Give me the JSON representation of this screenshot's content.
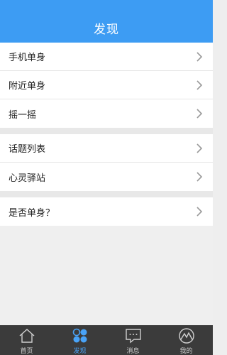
{
  "header": {
    "title": "发现"
  },
  "groups": [
    {
      "items": [
        {
          "label": "手机单身"
        },
        {
          "label": "附近单身"
        },
        {
          "label": "摇一摇"
        }
      ]
    },
    {
      "items": [
        {
          "label": "话题列表"
        },
        {
          "label": "心灵驿站"
        }
      ]
    },
    {
      "items": [
        {
          "label": "是否单身？"
        }
      ]
    }
  ],
  "tabbar": {
    "tabs": [
      {
        "label": "首页",
        "icon": "home-icon",
        "active": false
      },
      {
        "label": "发现",
        "icon": "discover-icon",
        "active": true
      },
      {
        "label": "消息",
        "icon": "message-icon",
        "active": false
      },
      {
        "label": "我的",
        "icon": "profile-icon",
        "active": false
      }
    ]
  },
  "colors": {
    "header_bg": "#3d9cf3",
    "tabbar_bg": "#3b3b3b",
    "active_tab": "#49a3f7",
    "inactive_tab": "#cfcfcf"
  }
}
